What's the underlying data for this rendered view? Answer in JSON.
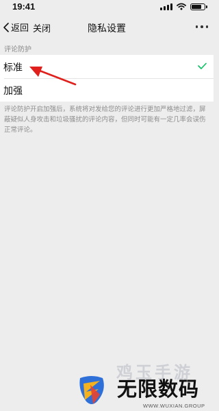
{
  "status_bar": {
    "time": "19:41"
  },
  "nav": {
    "back_label": "返回",
    "close_label": "关闭",
    "title": "隐私设置"
  },
  "section_header": "评论防护",
  "options": [
    {
      "label": "标准",
      "selected": true
    },
    {
      "label": "加强",
      "selected": false
    }
  ],
  "description": "评论防护开启加强后，系统将对发给您的评论进行更加严格地过滤，屏蔽疑似人身攻击和垃圾骚扰的评论内容，但同时可能有一定几率会误伤正常评论。",
  "watermark": {
    "upper_text": "鸡玉手游",
    "title": "无限数码",
    "subtitle": "WWW.WUXIAN.GROUP"
  },
  "colors": {
    "background": "#ededed",
    "check": "#07c160",
    "arrow": "#e0201c"
  }
}
